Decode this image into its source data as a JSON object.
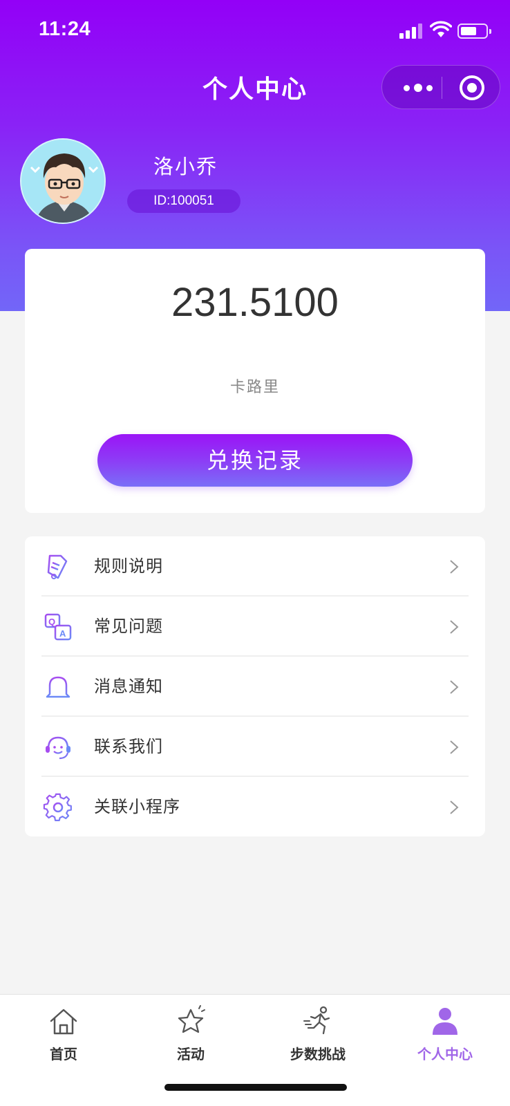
{
  "status_bar": {
    "time": "11:24"
  },
  "nav": {
    "title": "个人中心"
  },
  "profile": {
    "name": "洛小乔",
    "id_label": "ID:100051"
  },
  "calories": {
    "value": "231.5100",
    "unit": "卡路里",
    "button_label": "兑换记录"
  },
  "menu": [
    {
      "label": "规则说明",
      "icon": "document-icon"
    },
    {
      "label": "常见问题",
      "icon": "qa-icon"
    },
    {
      "label": "消息通知",
      "icon": "bell-icon"
    },
    {
      "label": "联系我们",
      "icon": "headset-icon"
    },
    {
      "label": "关联小程序",
      "icon": "gear-icon"
    }
  ],
  "tabbar": [
    {
      "label": "首页",
      "icon": "home-icon",
      "active": false
    },
    {
      "label": "活动",
      "icon": "star-icon",
      "active": false
    },
    {
      "label": "步数挑战",
      "icon": "runner-icon",
      "active": false
    },
    {
      "label": "个人中心",
      "icon": "person-icon",
      "active": true
    }
  ],
  "colors": {
    "primary": "#9300f7",
    "accent": "#7a6ef7",
    "active_tab": "#a066e8"
  }
}
